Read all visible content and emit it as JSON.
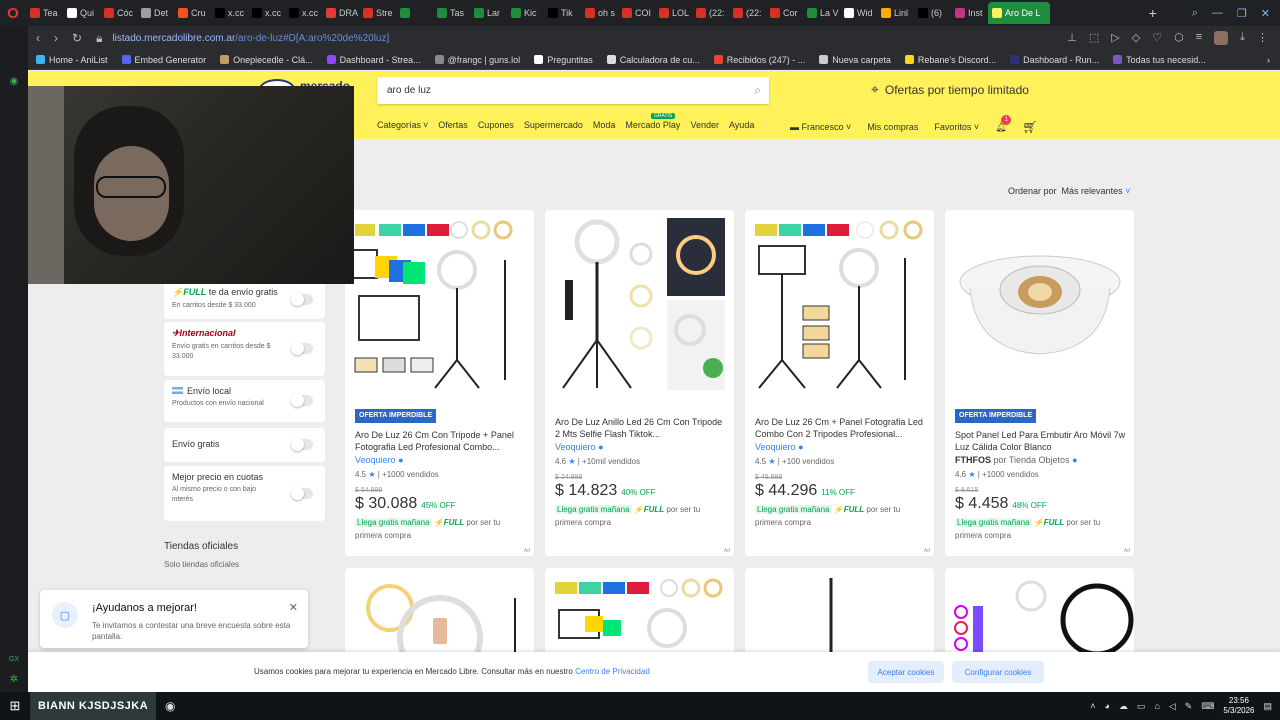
{
  "browser": {
    "tabs": [
      {
        "label": "Tea",
        "color": "#d93025"
      },
      {
        "label": "Qui",
        "color": "#ffffff"
      },
      {
        "label": "Cóc",
        "color": "#d93025"
      },
      {
        "label": "Det",
        "color": "#9e9e9e"
      },
      {
        "label": "Cru",
        "color": "#f4511e"
      },
      {
        "label": "x.cc",
        "color": "#000000"
      },
      {
        "label": "x.cc",
        "color": "#000000"
      },
      {
        "label": "x.cc",
        "color": "#000000"
      },
      {
        "label": "DRA",
        "color": "#e53935"
      },
      {
        "label": "Stre",
        "color": "#d93025"
      },
      {
        "label": "",
        "color": "#1e8e3e"
      },
      {
        "label": "Tas",
        "color": "#1e8e3e"
      },
      {
        "label": "Lar",
        "color": "#1e8e3e"
      },
      {
        "label": "Kic",
        "color": "#1e8e3e"
      },
      {
        "label": "Tik",
        "color": "#000000"
      },
      {
        "label": "oh s",
        "color": "#d93025"
      },
      {
        "label": "COI",
        "color": "#d93025"
      },
      {
        "label": "LOL",
        "color": "#d93025"
      },
      {
        "label": "(22:",
        "color": "#d93025"
      },
      {
        "label": "(22:",
        "color": "#d93025"
      },
      {
        "label": "Cor",
        "color": "#d93025"
      },
      {
        "label": "La V",
        "color": "#1e8e3e"
      },
      {
        "label": "Wid",
        "color": "#ffffff"
      },
      {
        "label": "Linl",
        "color": "#f9ab00"
      },
      {
        "label": "(6)",
        "color": "#000000"
      },
      {
        "label": "Inst",
        "color": "#c13584"
      }
    ],
    "active_tab": "Aro De L",
    "url_host": "listado.mercadolibre.com.ar",
    "url_path": "/aro-de-luz#D[A:aro%20de%20luz]",
    "bookmarks": [
      {
        "label": "Home - AniList",
        "color": "#3db4f2"
      },
      {
        "label": "Embed Generator",
        "color": "#5865f2"
      },
      {
        "label": "Onepiecedle - Clá...",
        "color": "#c0a062"
      },
      {
        "label": "Dashboard - Strea...",
        "color": "#9146ff"
      },
      {
        "label": "@frangc | guns.lol",
        "color": "#888888"
      },
      {
        "label": "Preguntitas",
        "color": "#ffffff"
      },
      {
        "label": "Calculadora de cu...",
        "color": "#dddddd"
      },
      {
        "label": "Recibidos (247) - ...",
        "color": "#ea4335"
      },
      {
        "label": "Nueva carpeta",
        "color": "#cccccc"
      },
      {
        "label": "Rebane's Discord...",
        "color": "#f9d71c"
      },
      {
        "label": "Dashboard - Run...",
        "color": "#2d3277"
      },
      {
        "label": "Todas tus necesid...",
        "color": "#7e57c2"
      }
    ]
  },
  "header": {
    "logo_text": "mercado libre",
    "search_value": "aro de luz",
    "promo": "Ofertas por tiempo limitado",
    "nav": [
      "Categorías",
      "Ofertas",
      "Cupones",
      "Supermercado",
      "Moda",
      "Mercado Play",
      "Vender",
      "Ayuda"
    ],
    "new_badge": "GRATIS",
    "user": "Francesco",
    "mis_compras": "Mis compras",
    "favoritos": "Favoritos",
    "notif_count": "1"
  },
  "sort": {
    "label": "Ordenar por",
    "value": "Más relevantes"
  },
  "filters": [
    {
      "tag": "FULL",
      "title": "te da envío gratis",
      "sub": "En carritos desde $ 33.000"
    },
    {
      "tag": "Internacional",
      "title": "",
      "sub": "Envío gratis en carritos desde $ 33.000"
    },
    {
      "title": "Envío local",
      "sub": "Productos con envío nacional"
    },
    {
      "title": "Envío gratis",
      "sub": ""
    },
    {
      "title": "Mejor precio en cuotas",
      "sub": "Al mismo precio o con bajo interés"
    }
  ],
  "tiendas": {
    "title": "Tiendas oficiales",
    "sub": "Solo tiendas oficiales"
  },
  "products": [
    {
      "badge": "OFERTA IMPERDIBLE",
      "title": "Aro De Luz 26 Cm Con Tripode + Panel Fotografia Led Profesional Combo...",
      "seller": "Veoquiero",
      "rating": "4.5",
      "sold": "+1000 vendidos",
      "old": "$ 54.999",
      "price": "$ 30.088",
      "disc": "45% OFF",
      "ship_free": "Llega gratis mañana",
      "ship_tail": "por ser tu primera compra"
    },
    {
      "badge": "",
      "title": "Aro De Luz Anillo Led 26 Cm Con Tripode 2 Mts Selfie Flash Tiktok...",
      "seller": "Veoquiero",
      "rating": "4.6",
      "sold": "+10mil vendidos",
      "old": "$ 24.999",
      "price": "$ 14.823",
      "disc": "40% OFF",
      "ship_free": "Llega gratis mañana",
      "ship_tail": "por ser tu primera compra"
    },
    {
      "badge": "",
      "title": "Aro De Luz 26 Cm + Panel Fotografia Led Combo Con 2 Tripodes Profesional...",
      "seller": "Veoquiero",
      "rating": "4.5",
      "sold": "+100 vendidos",
      "old": "$ 49.999",
      "price": "$ 44.296",
      "disc": "11% OFF",
      "ship_free": "Llega gratis mañana",
      "ship_tail": "por ser tu primera compra"
    },
    {
      "badge": "OFERTA IMPERDIBLE",
      "title": "Spot Panel Led Para Embutir Aro Móvil 7w Luz Cálida Color Blanco",
      "seller": "FTHFOS",
      "seller_prefix": "por Tienda Objetos",
      "rating": "4.6",
      "sold": "+1000 vendidos",
      "old": "$ 8.615",
      "price": "$ 4.458",
      "disc": "48% OFF",
      "ship_free": "Llega gratis mañana",
      "ship_tail": "por ser tu primera compra"
    }
  ],
  "full_label": "FULL",
  "ad_label": "Ad",
  "help": {
    "title": "¡Ayudanos a mejorar!",
    "sub": "Te invitamos a contestar una breve encuesta sobre esta pantalla."
  },
  "cookie": {
    "msg": "Usamos cookies para mejorar tu experiencia en Mercado Libre. Consultar más en nuestro",
    "link": "Centro de Privacidad",
    "accept": "Aceptar cookies",
    "config": "Configurar cookies"
  },
  "taskbar": {
    "label": "BIANN KJSDJSJKA",
    "time": "23:56",
    "date": "5/3/2026"
  }
}
